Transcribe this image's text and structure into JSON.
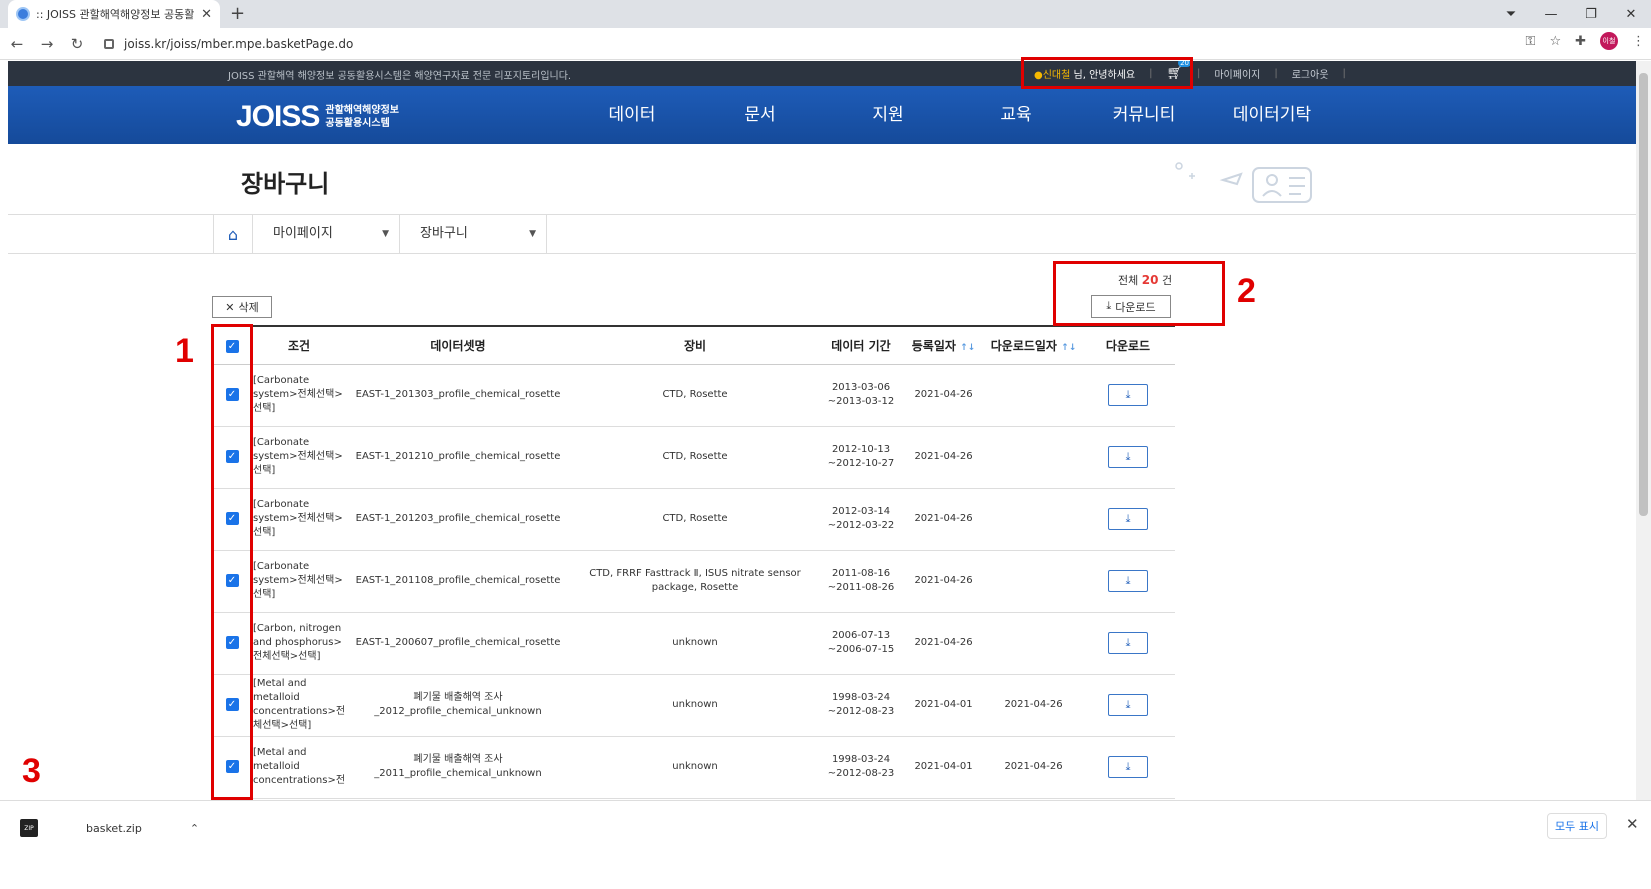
{
  "browser": {
    "tab_title": ":: JOISS 관할해역해양정보 공동활",
    "url": "joiss.kr/joiss/mber.mpe.basketPage.do",
    "profile": "이철"
  },
  "site": {
    "topbar_desc": "JOISS 관할해역 해양정보 공동활용시스템은 해양연구자료 전문 리포지토리입니다.",
    "user_name": "신대철",
    "user_greeting": "님, 안녕하세요",
    "cart_count": "20",
    "mypage_link": "마이페이지",
    "logout_link": "로그아웃",
    "logo_text": "JOISS",
    "logo_sub1": "관할해역해양정보",
    "logo_sub2": "공동활용시스템",
    "nav": [
      "데이터",
      "문서",
      "지원",
      "교육",
      "커뮤니티",
      "데이터기탁"
    ],
    "page_title": "장바구니",
    "breadcrumb": [
      "마이페이지",
      "장바구니"
    ]
  },
  "basket": {
    "delete_label": "삭제",
    "total_prefix": "전체",
    "total_count": "20",
    "total_suffix": "건",
    "download_label": "다운로드",
    "columns": [
      "조건",
      "데이터셋명",
      "장비",
      "데이터 기간",
      "등록일자",
      "다운로드일자",
      "다운로드"
    ],
    "rows": [
      {
        "cond": [
          "[Carbonate",
          "system>전체선택>",
          "선택]"
        ],
        "name": [
          "EAST-1_201303_profile_chemical_rosette"
        ],
        "equip": [
          "CTD, Rosette"
        ],
        "period": [
          "2013-03-06",
          "~2013-03-12"
        ],
        "reg": "2021-04-26",
        "dl": ""
      },
      {
        "cond": [
          "[Carbonate",
          "system>전체선택>",
          "선택]"
        ],
        "name": [
          "EAST-1_201210_profile_chemical_rosette"
        ],
        "equip": [
          "CTD, Rosette"
        ],
        "period": [
          "2012-10-13",
          "~2012-10-27"
        ],
        "reg": "2021-04-26",
        "dl": ""
      },
      {
        "cond": [
          "[Carbonate",
          "system>전체선택>",
          "선택]"
        ],
        "name": [
          "EAST-1_201203_profile_chemical_rosette"
        ],
        "equip": [
          "CTD, Rosette"
        ],
        "period": [
          "2012-03-14",
          "~2012-03-22"
        ],
        "reg": "2021-04-26",
        "dl": ""
      },
      {
        "cond": [
          "[Carbonate",
          "system>전체선택>",
          "선택]"
        ],
        "name": [
          "EAST-1_201108_profile_chemical_rosette"
        ],
        "equip": [
          "CTD, FRRF Fasttrack Ⅱ, ISUS nitrate sensor",
          "package, Rosette"
        ],
        "period": [
          "2011-08-16",
          "~2011-08-26"
        ],
        "reg": "2021-04-26",
        "dl": ""
      },
      {
        "cond": [
          "[Carbon, nitrogen",
          "and phosphorus>",
          "전체선택>선택]"
        ],
        "name": [
          "EAST-1_200607_profile_chemical_rosette"
        ],
        "equip": [
          "unknown"
        ],
        "period": [
          "2006-07-13",
          "~2006-07-15"
        ],
        "reg": "2021-04-26",
        "dl": ""
      },
      {
        "cond": [
          "[Metal and",
          "metalloid",
          "concentrations>전",
          "체선택>선택]"
        ],
        "name": [
          "폐기물 배출해역 조사",
          "_2012_profile_chemical_unknown"
        ],
        "equip": [
          "unknown"
        ],
        "period": [
          "1998-03-24",
          "~2012-08-23"
        ],
        "reg": "2021-04-01",
        "dl": "2021-04-26"
      },
      {
        "cond": [
          "[Metal and",
          "metalloid",
          "concentrations>전"
        ],
        "name": [
          "폐기물 배출해역 조사",
          "_2011_profile_chemical_unknown"
        ],
        "equip": [
          "unknown"
        ],
        "period": [
          "1998-03-24",
          "~2012-08-23"
        ],
        "reg": "2021-04-01",
        "dl": "2021-04-26"
      }
    ]
  },
  "annotations": {
    "n1": "1",
    "n2": "2",
    "n3": "3",
    "color": "#e00000"
  },
  "download_shelf": {
    "file": "basket.zip",
    "show_all": "모두 표시"
  }
}
